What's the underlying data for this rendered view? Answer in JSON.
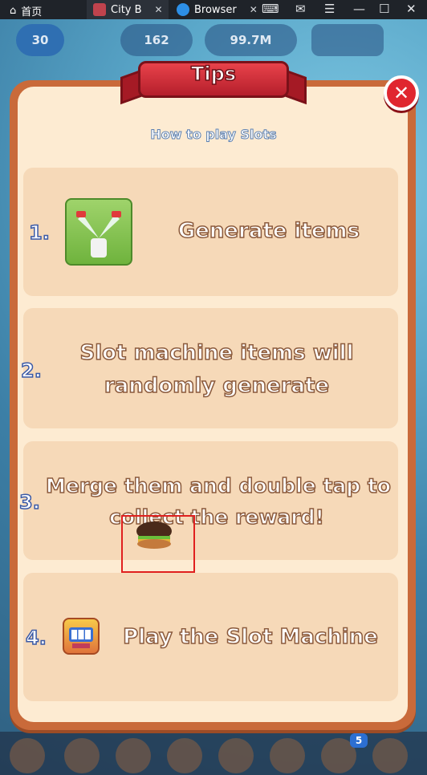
{
  "browser": {
    "home_label": "首页",
    "tabs": [
      {
        "label": "City B",
        "active": true
      },
      {
        "label": "Browser",
        "active": false
      }
    ]
  },
  "hud": {
    "level": "30",
    "gems": "162",
    "coins": "99.7M"
  },
  "dialog": {
    "title": "Tips",
    "subtitle": "How to play Slots",
    "steps": [
      {
        "number": "1.",
        "text": "Generate items"
      },
      {
        "number": "2.",
        "text_line1": "Slot machine items will",
        "text_line2": "randomly generate"
      },
      {
        "number": "3.",
        "text_line1": "Merge them and double tap to",
        "text_line2": "collect the reward!"
      },
      {
        "number": "4.",
        "text": "Play the Slot Machine"
      }
    ]
  },
  "bottom_badge": "5",
  "colors": {
    "accent_red": "#e0262f",
    "panel": "#f6d9b8",
    "number_outline": "#3b5aa6"
  }
}
